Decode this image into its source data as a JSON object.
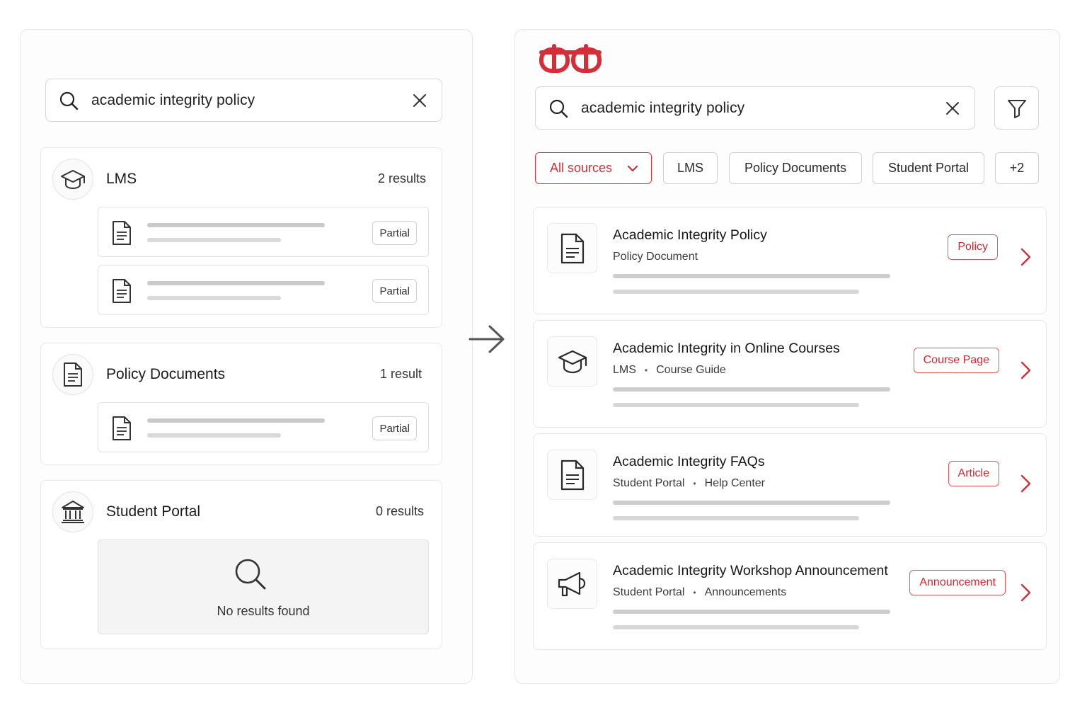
{
  "left": {
    "search": {
      "query": "academic integrity policy"
    },
    "groups": [
      {
        "title": "LMS",
        "count": "2 results",
        "rows": [
          {
            "badge": "Partial"
          },
          {
            "badge": "Partial"
          }
        ]
      },
      {
        "title": "Policy Documents",
        "count": "1 result",
        "rows": [
          {
            "badge": "Partial"
          }
        ]
      },
      {
        "title": "Student Portal",
        "count": "0 results",
        "empty_text": "No results found"
      }
    ]
  },
  "right": {
    "search": {
      "query": "academic integrity policy"
    },
    "chips": [
      "All sources",
      "LMS",
      "Policy Documents",
      "Student Portal",
      "+2"
    ],
    "results": [
      {
        "title": "Academic Integrity Policy",
        "source": "Policy Document",
        "category": "",
        "tag": "Policy",
        "icon": "document-icon"
      },
      {
        "title": "Academic Integrity in Online Courses",
        "source": "LMS",
        "category": "Course Guide",
        "tag": "Course Page",
        "icon": "graduation-cap-icon"
      },
      {
        "title": "Academic Integrity FAQs",
        "source": "Student Portal",
        "category": "Help Center",
        "tag": "Article",
        "icon": "document-icon"
      },
      {
        "title": "Academic Integrity Workshop Announcement",
        "source": "Student Portal",
        "category": "Announcements",
        "tag": "Announcement",
        "icon": "megaphone-icon"
      }
    ],
    "separator": "•"
  },
  "colors": {
    "accent": "#d22f38",
    "border": "#e6e6e6",
    "skeleton": "#cdcdcd"
  }
}
